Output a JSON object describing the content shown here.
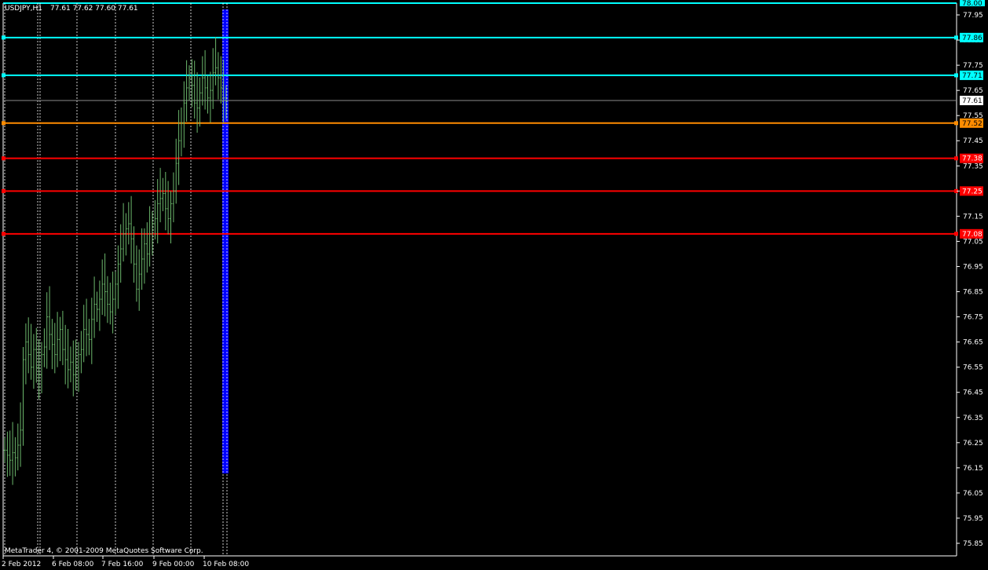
{
  "header": {
    "symbol": "USDJPY,H1",
    "ohlc": "77.61 77.62 77.60 77.61"
  },
  "copyright": "MetaTrader 4, © 2001-2009 MetaQuotes Software Corp.",
  "time_labels": [
    "2 Feb 2012",
    "6 Feb 08:00",
    "7 Feb 16:00",
    "9 Feb 00:00",
    "10 Feb 08:00"
  ],
  "price_axis_ticks": [
    "77.95",
    "77.85",
    "77.75",
    "77.65",
    "77.55",
    "77.45",
    "77.35",
    "77.25",
    "77.15",
    "77.05",
    "76.95",
    "76.85",
    "76.75",
    "76.65",
    "76.55",
    "76.45",
    "76.35",
    "76.25",
    "76.15",
    "76.05",
    "75.95",
    "75.85"
  ],
  "current_price": "77.61",
  "horizontal_lines": [
    {
      "label": "77.86",
      "color": "#00FFFF"
    },
    {
      "label": "77.71",
      "color": "#00FFFF"
    },
    {
      "label": "77.52",
      "color": "#FF8C00"
    },
    {
      "label": "77.38",
      "color": "#FF0000"
    },
    {
      "label": "77.25",
      "color": "#FF0000"
    },
    {
      "label": "77.08",
      "color": "#FF0000"
    }
  ],
  "top_line_label": "78.00",
  "colors": {
    "background": "#000000",
    "bars": "#6CB86C",
    "grid": "#FFFFFF",
    "highlight_band": "#0000FF"
  },
  "chart_data": {
    "type": "bar",
    "symbol": "USDJPY",
    "timeframe": "H1",
    "y_range": [
      75.8,
      78.0
    ],
    "close_series_approx": [
      76.22,
      76.2,
      76.18,
      76.21,
      76.19,
      76.24,
      76.3,
      76.58,
      76.65,
      76.6,
      76.55,
      76.62,
      76.55,
      76.52,
      76.6,
      76.63,
      76.75,
      76.68,
      76.64,
      76.6,
      76.66,
      76.7,
      76.62,
      76.58,
      76.54,
      76.57,
      76.52,
      76.55,
      76.6,
      76.62,
      76.7,
      76.68,
      76.66,
      76.74,
      76.8,
      76.78,
      76.82,
      76.88,
      76.85,
      76.8,
      76.77,
      76.82,
      76.88,
      76.96,
      77.02,
      77.08,
      77.1,
      77.12,
      77.06,
      76.96,
      76.86,
      76.92,
      76.98,
      77.04,
      77.0,
      77.08,
      77.12,
      77.14,
      77.2,
      77.22,
      77.24,
      77.18,
      77.14,
      77.2,
      77.25,
      77.36,
      77.45,
      77.52,
      77.6,
      77.66,
      77.7,
      77.67,
      77.6,
      77.58,
      77.64,
      77.7,
      77.66,
      77.62,
      77.65,
      77.72,
      77.74,
      77.7,
      77.66,
      77.62,
      77.61
    ]
  }
}
